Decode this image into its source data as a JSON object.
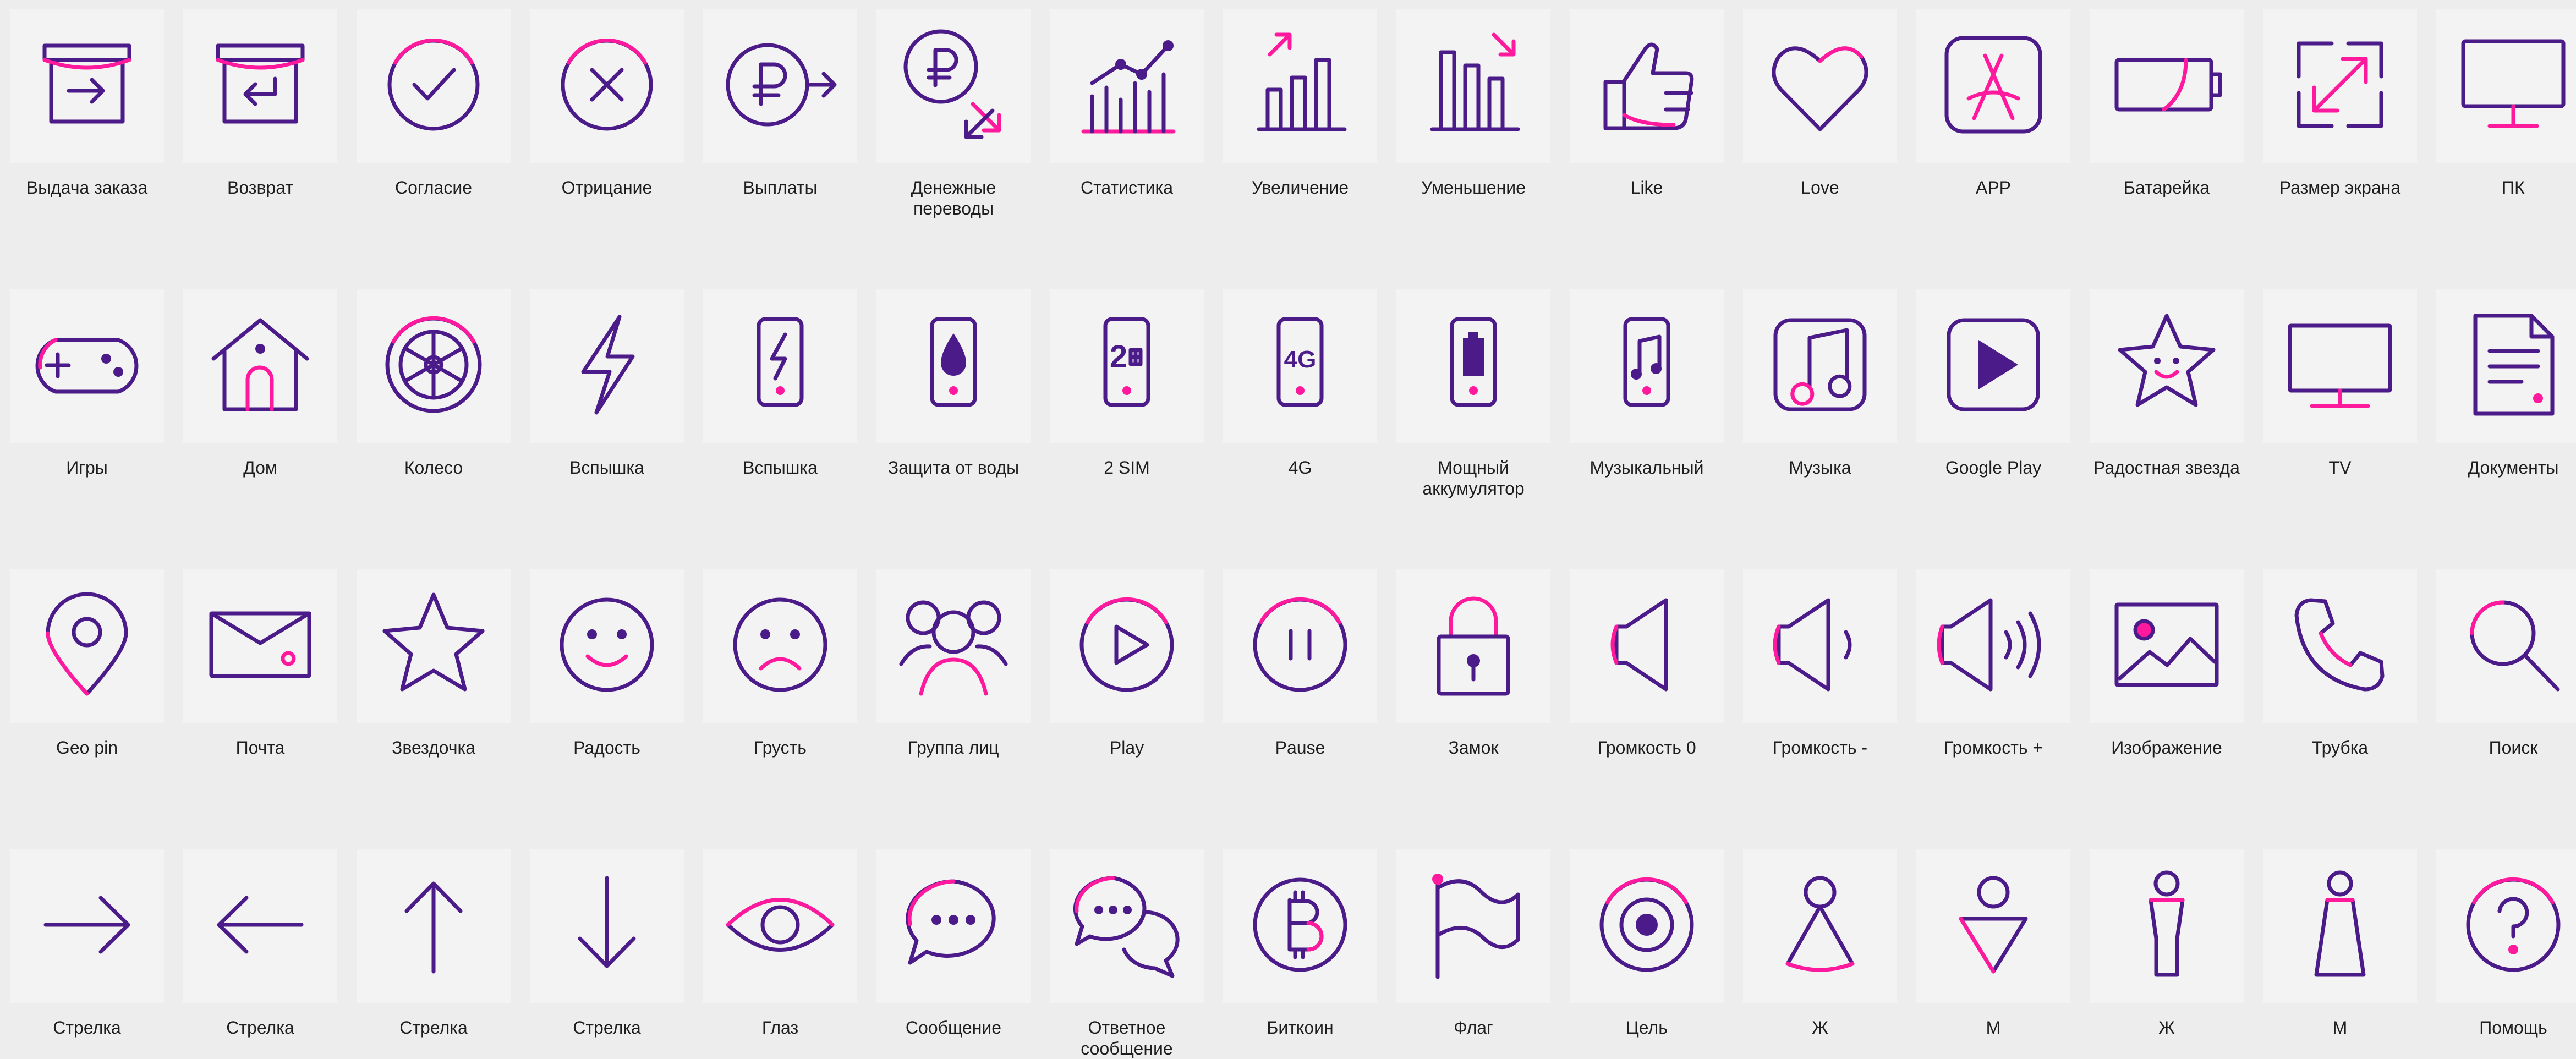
{
  "colors": {
    "primary": "#4b1b8a",
    "accent": "#ff1a9d",
    "tile": "#f3f3f3",
    "background": "#ededed"
  },
  "rows": [
    [
      {
        "icon": "delivery-box-icon",
        "label": "Выдача заказа"
      },
      {
        "icon": "return-box-icon",
        "label": "Возврат"
      },
      {
        "icon": "checkmark-circle-icon",
        "label": "Согласие"
      },
      {
        "icon": "cross-circle-icon",
        "label": "Отрицание"
      },
      {
        "icon": "ruble-payout-icon",
        "label": "Выплаты"
      },
      {
        "icon": "ruble-transfer-icon",
        "label": "Денежные\nпереводы"
      },
      {
        "icon": "statistics-chart-icon",
        "label": "Статистика"
      },
      {
        "icon": "increase-chart-icon",
        "label": "Увеличение"
      },
      {
        "icon": "decrease-chart-icon",
        "label": "Уменьшение"
      },
      {
        "icon": "thumbs-up-icon",
        "label": "Like"
      },
      {
        "icon": "heart-icon",
        "label": "Love"
      },
      {
        "icon": "app-store-icon",
        "label": "APP"
      },
      {
        "icon": "battery-icon",
        "label": "Батарейка"
      },
      {
        "icon": "expand-screen-icon",
        "label": "Размер экрана"
      },
      {
        "icon": "desktop-pc-icon",
        "label": "ПК"
      }
    ],
    [
      {
        "icon": "gamepad-icon",
        "label": "Игры"
      },
      {
        "icon": "house-icon",
        "label": "Дом"
      },
      {
        "icon": "wheel-icon",
        "label": "Колесо"
      },
      {
        "icon": "lightning-icon",
        "label": "Вспышка"
      },
      {
        "icon": "phone-flash-icon",
        "label": "Вспышка"
      },
      {
        "icon": "phone-waterproof-icon",
        "label": "Защита от воды"
      },
      {
        "icon": "phone-dual-sim-icon",
        "label": "2 SIM"
      },
      {
        "icon": "phone-4g-icon",
        "label": "4G"
      },
      {
        "icon": "phone-battery-icon",
        "label": "Мощный\nаккумулятор"
      },
      {
        "icon": "phone-music-icon",
        "label": "Музыкальный"
      },
      {
        "icon": "music-app-icon",
        "label": "Музыка"
      },
      {
        "icon": "google-play-icon",
        "label": "Google Play"
      },
      {
        "icon": "smiling-star-icon",
        "label": "Радостная звезда"
      },
      {
        "icon": "tv-icon",
        "label": "TV"
      },
      {
        "icon": "document-icon",
        "label": "Документы"
      }
    ],
    [
      {
        "icon": "geo-pin-icon",
        "label": "Geo pin"
      },
      {
        "icon": "mail-envelope-icon",
        "label": "Почта"
      },
      {
        "icon": "star-icon",
        "label": "Звездочка"
      },
      {
        "icon": "happy-face-icon",
        "label": "Радость"
      },
      {
        "icon": "sad-face-icon",
        "label": "Грусть"
      },
      {
        "icon": "people-group-icon",
        "label": "Группа лиц"
      },
      {
        "icon": "play-icon",
        "label": "Play"
      },
      {
        "icon": "pause-icon",
        "label": "Pause"
      },
      {
        "icon": "padlock-icon",
        "label": "Замок"
      },
      {
        "icon": "volume-mute-icon",
        "label": "Громкость 0"
      },
      {
        "icon": "volume-low-icon",
        "label": "Громкость -"
      },
      {
        "icon": "volume-high-icon",
        "label": "Громкость +"
      },
      {
        "icon": "image-icon",
        "label": "Изображение"
      },
      {
        "icon": "phone-handset-icon",
        "label": "Трубка"
      },
      {
        "icon": "search-icon",
        "label": "Поиск"
      }
    ],
    [
      {
        "icon": "arrow-right-icon",
        "label": "Стрелка"
      },
      {
        "icon": "arrow-left-icon",
        "label": "Стрелка"
      },
      {
        "icon": "arrow-up-icon",
        "label": "Стрелка"
      },
      {
        "icon": "arrow-down-icon",
        "label": "Стрелка"
      },
      {
        "icon": "eye-icon",
        "label": "Глаз"
      },
      {
        "icon": "chat-bubble-icon",
        "label": "Сообщение"
      },
      {
        "icon": "reply-bubbles-icon",
        "label": "Ответное\nсообщение"
      },
      {
        "icon": "bitcoin-icon",
        "label": "Биткоин"
      },
      {
        "icon": "flag-icon",
        "label": "Флаг"
      },
      {
        "icon": "target-icon",
        "label": "Цель"
      },
      {
        "icon": "female-icon",
        "label": "Ж"
      },
      {
        "icon": "male-icon",
        "label": "М"
      },
      {
        "icon": "female-alt-icon",
        "label": "Ж"
      },
      {
        "icon": "male-alt-icon",
        "label": "М"
      },
      {
        "icon": "help-icon",
        "label": "Помощь"
      }
    ]
  ]
}
